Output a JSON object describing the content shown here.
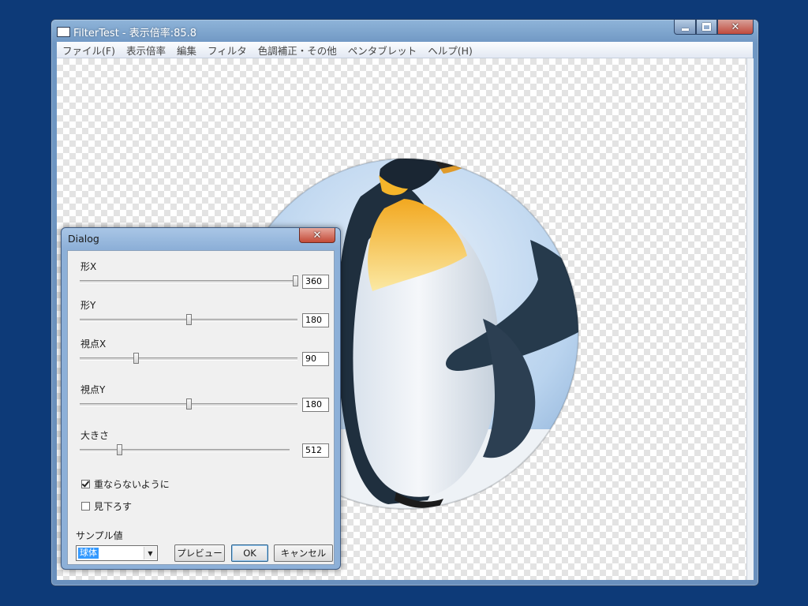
{
  "window": {
    "title": "FilterTest - 表示倍率:85.8",
    "min_glyph": "minimize",
    "max_glyph": "maximize",
    "close_glyph": "✕"
  },
  "menu": [
    "ファイル(F)",
    "表示倍率",
    "編集",
    "フィルタ",
    "色調補正・その他",
    "ペンタブレット",
    "ヘルプ(H)"
  ],
  "dialog": {
    "title": "Dialog",
    "close_glyph": "✕",
    "sliders": [
      {
        "label": "形X",
        "value": "360",
        "fraction": 1.0
      },
      {
        "label": "形Y",
        "value": "180",
        "fraction": 0.5
      },
      {
        "label": "視点X",
        "value": "90",
        "fraction": 0.25
      },
      {
        "label": "視点Y",
        "value": "180",
        "fraction": 0.5
      },
      {
        "label": "大きさ",
        "value": "512",
        "fraction": 0.18
      }
    ],
    "checks": [
      {
        "label": "重ならないように",
        "checked": true
      },
      {
        "label": "見下ろす",
        "checked": false
      }
    ],
    "sample_label": "サンプル値",
    "sample_value": "球体",
    "combo_arrow": "▼",
    "buttons": {
      "preview": "プレビュー",
      "ok": "OK",
      "cancel": "キャンセル"
    }
  },
  "colors": {
    "desktop": "#0d3a78",
    "sky": "#b9d3ee",
    "penguin_dark": "#1f2f3e",
    "penguin_yellow": "#f2c230"
  }
}
